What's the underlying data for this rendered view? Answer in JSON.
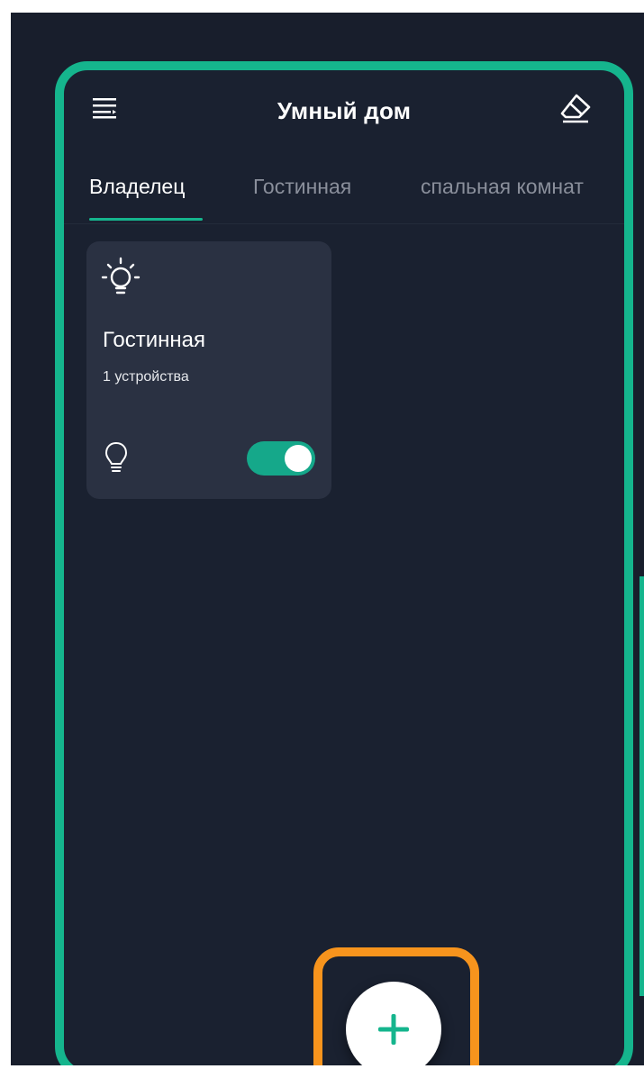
{
  "header": {
    "title": "Умный дом",
    "menu_icon": "menu-icon",
    "action_icon": "eraser-icon"
  },
  "tabs": [
    {
      "label": "Владелец",
      "active": true
    },
    {
      "label": "Гостинная",
      "active": false
    },
    {
      "label": "спальная комнат",
      "active": false
    }
  ],
  "room_card": {
    "title": "Гостинная",
    "subtitle": "1 устройства",
    "icon": "lightbulb-icon",
    "device_icon": "lightbulb-outline-icon",
    "toggle_on": true
  },
  "fab": {
    "icon": "plus-icon"
  },
  "colors": {
    "accent": "#15b58d",
    "background": "#1a2130",
    "card": "#2a3142",
    "highlight": "#f7941d"
  }
}
